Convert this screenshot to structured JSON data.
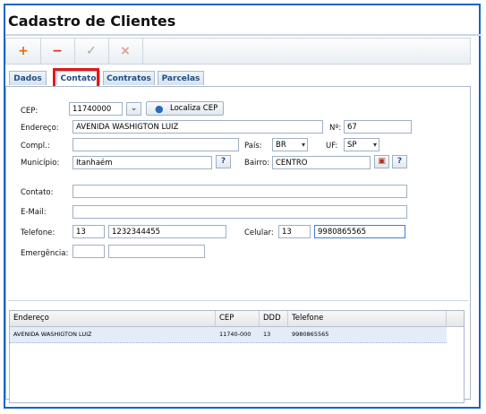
{
  "window": {
    "title": "Cadastro de Clientes"
  },
  "toolbar": {
    "buttons": [
      {
        "glyph": "+",
        "color": "#e06a10"
      },
      {
        "glyph": "−",
        "color": "#e0281a"
      },
      {
        "glyph": "✓",
        "color": "#8fb58f"
      },
      {
        "glyph": "×",
        "color": "#e49a90"
      }
    ]
  },
  "tabs": [
    {
      "label": "Dados"
    },
    {
      "label": "Contato"
    },
    {
      "label": "Contratos"
    },
    {
      "label": "Parcelas"
    }
  ],
  "form": {
    "cep": {
      "label": "CEP:",
      "value": "11740000"
    },
    "localiza": {
      "label": "Localiza CEP"
    },
    "endereco": {
      "label": "Endereço:",
      "value": "AVENIDA WASHIGTON LUIZ"
    },
    "numero": {
      "label": "Nº:",
      "value": "67"
    },
    "compl": {
      "label": "Compl.:",
      "value": ""
    },
    "pais": {
      "label": "País:",
      "value": "BR"
    },
    "uf": {
      "label": "UF:",
      "value": "SP"
    },
    "municipio": {
      "label": "Município:",
      "value": "Itanhaém"
    },
    "bairro": {
      "label": "Bairro:",
      "value": "CENTRO"
    },
    "contato": {
      "label": "Contato:",
      "value": ""
    },
    "email": {
      "label": "E-Mail:",
      "value": ""
    },
    "telefone": {
      "label": "Telefone:",
      "ddd": "13",
      "value": "1232344455"
    },
    "celular": {
      "label": "Celular:",
      "ddd": "13",
      "value": "9980865565"
    },
    "emergencia": {
      "label": "Emergência:",
      "ddd": "",
      "value": ""
    }
  },
  "grid": {
    "columns": [
      "Endereço",
      "CEP",
      "DDD",
      "Telefone"
    ],
    "rows": [
      [
        "AVENIDA WASHIGTON LUIZ",
        "11740-000",
        "13",
        "9980865565"
      ]
    ]
  }
}
